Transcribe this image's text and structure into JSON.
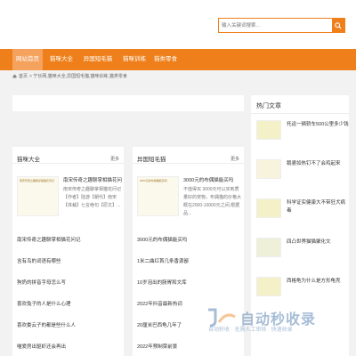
{
  "search": {
    "placeholder": "输入关键词搜索..."
  },
  "nav": {
    "items": [
      {
        "label": "网站首页"
      },
      {
        "label": "猫咪大全"
      },
      {
        "label": "异国短毛猫"
      },
      {
        "label": "猫咪训练"
      },
      {
        "label": "猫类零食"
      }
    ]
  },
  "breadcrumb": {
    "home": "首页",
    "path": "> 宁长网,猫咪大全,异国短毛猫,猫咪训练,猫类零食"
  },
  "columns": [
    {
      "title": "猫咪大全",
      "more": "更多",
      "featured": {
        "image_caption": "南宋传奇之趣聊掌相猫花问记",
        "title": "南宋传奇之趣聊掌相猫花问记",
        "desc": "南宋传奇之趣聊掌相猫花问记【作者】陆游【朝代】南宋【体裁】七言绝句【原文】..."
      },
      "items": [
        "南宋传奇之趣聊掌相猫花问记",
        "含有鸟的词语有哪些",
        "狗奶的拼音字母怎么写",
        "喜欢兔子的人是什么心理",
        "喜欢娄云子的都是些什么人",
        "喵爱房出驱虾还会再出"
      ]
    },
    {
      "title": "异国短毛猫",
      "more": "更多",
      "featured": {
        "image_caption": "3000元的布偶猫能买吗",
        "title": "3000元的布偶猫能买吗",
        "desc": "不值得买 3000元可以买到质量好的宠物，布偶猫的价格大概在2000-10000元之间,根据品..."
      },
      "items": [
        "3000元的布偶猫能买吗",
        "1米二曲红首几条香源鄙",
        "10岁泡出的肠胃和文库",
        "2022年抖音最新热词",
        "20厘米巴西龟几年了",
        "2022年预制菜前景"
      ]
    }
  ],
  "sidebar": {
    "title": "热门文章",
    "items": [
      {
        "text": "托运一辆轿车500公里多少钱"
      },
      {
        "text": "鹅婆如热钉不了会鸡起来"
      },
      {
        "text": "科学证实健康大不带狂犬病毒"
      },
      {
        "text": "四凸世界猫猫聚化文"
      },
      {
        "text": "西格龟为什么是方形龟壳"
      }
    ]
  },
  "watermark": {
    "text": "自动秒收录",
    "sub": "自动秒收 · 无需人工审核 · 快速收录"
  },
  "colors": {
    "accent": "#ef7f1a",
    "background": "#f2f2f2"
  }
}
